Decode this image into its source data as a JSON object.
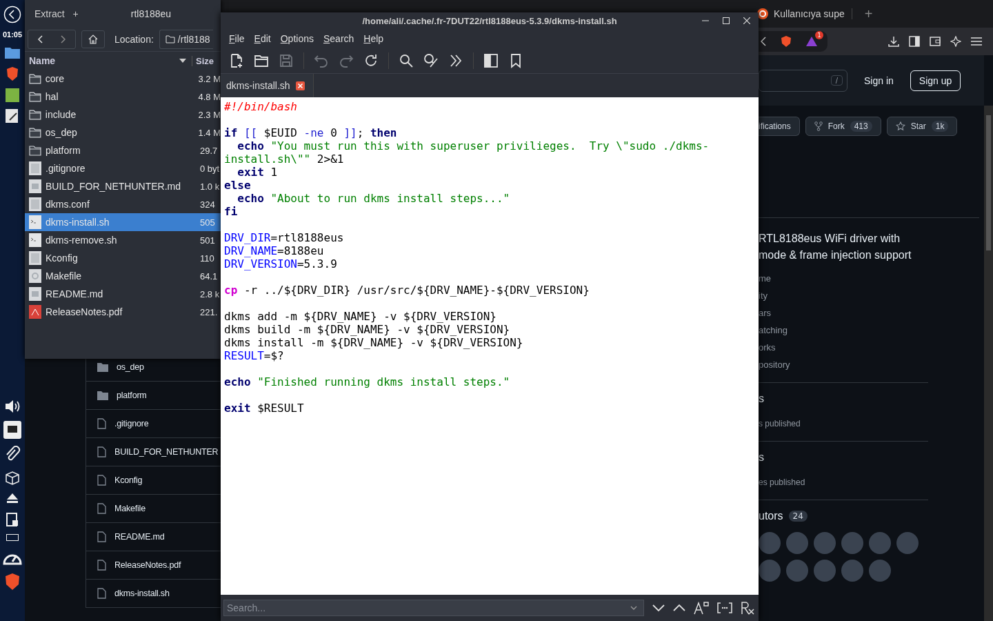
{
  "dock": {
    "time": "01:05"
  },
  "browser": {
    "tab_title": "Kullanıcıya supe",
    "new_tab": "+",
    "alert_count": "1",
    "header": {
      "search_key": "/",
      "sign_in": "Sign in",
      "sign_up": "Sign up"
    },
    "repo_actions": [
      {
        "label": "ifications"
      },
      {
        "label": "Fork",
        "count": "413"
      },
      {
        "label": "Star",
        "count": "1k"
      }
    ],
    "description": [
      "RTL8188eus WiFi driver with",
      "mode & frame injection support"
    ],
    "about_links": [
      "me",
      "ity",
      "ars",
      "atching",
      "orks",
      "pository"
    ],
    "sections": [
      {
        "heading": "s",
        "text": "s published"
      },
      {
        "heading": "s",
        "text": "es published"
      }
    ],
    "contributors": {
      "heading": "utors",
      "count": "24"
    },
    "files": [
      {
        "name": "os_dep",
        "kind": "folder"
      },
      {
        "name": "platform",
        "kind": "folder"
      },
      {
        "name": ".gitignore",
        "kind": "file"
      },
      {
        "name": "BUILD_FOR_NETHUNTER",
        "kind": "file"
      },
      {
        "name": "Kconfig",
        "kind": "file"
      },
      {
        "name": "Makefile",
        "kind": "file"
      },
      {
        "name": "README.md",
        "kind": "file"
      },
      {
        "name": "ReleaseNotes.pdf",
        "kind": "file"
      },
      {
        "name": "dkms-install.sh",
        "kind": "file"
      }
    ]
  },
  "archive": {
    "extract": "Extract",
    "add": "+",
    "tab_title": "rtl8188eu",
    "location_label": "Location:",
    "location": "/rtl8188",
    "columns": [
      "Name",
      "Size"
    ],
    "rows": [
      {
        "name": "core",
        "size": "3.2 M",
        "kind": "folder",
        "selected": false
      },
      {
        "name": "hal",
        "size": "4.8 M",
        "kind": "folder",
        "selected": false
      },
      {
        "name": "include",
        "size": "2.3 M",
        "kind": "folder",
        "selected": false
      },
      {
        "name": "os_dep",
        "size": "1.4 M",
        "kind": "folder",
        "selected": false
      },
      {
        "name": "platform",
        "size": "29.7",
        "kind": "folder",
        "selected": false
      },
      {
        "name": ".gitignore",
        "size": "0 byt",
        "kind": "text",
        "selected": false
      },
      {
        "name": "BUILD_FOR_NETHUNTER.md",
        "size": "1.0 k",
        "kind": "markdown",
        "selected": false
      },
      {
        "name": "dkms.conf",
        "size": "324",
        "kind": "text",
        "selected": false
      },
      {
        "name": "dkms-install.sh",
        "size": "505",
        "kind": "script",
        "selected": true
      },
      {
        "name": "dkms-remove.sh",
        "size": "501",
        "kind": "script",
        "selected": false
      },
      {
        "name": "Kconfig",
        "size": "110",
        "kind": "text",
        "selected": false
      },
      {
        "name": "Makefile",
        "size": "64.1",
        "kind": "settings",
        "selected": false
      },
      {
        "name": "README.md",
        "size": "2.8 k",
        "kind": "markdown",
        "selected": false
      },
      {
        "name": "ReleaseNotes.pdf",
        "size": "221.",
        "kind": "pdf",
        "selected": false
      }
    ]
  },
  "editor": {
    "title": "/home/ali/.cache/.fr-7DUT22/rtl8188eus-5.3.9/dkms-install.sh",
    "menu": [
      "File",
      "Edit",
      "Options",
      "Search",
      "Help"
    ],
    "toolbar_groups": [
      [
        {
          "kind": "new",
          "disabled": false
        },
        {
          "kind": "open",
          "disabled": false
        },
        {
          "kind": "save",
          "disabled": true
        }
      ],
      [
        {
          "kind": "undo",
          "disabled": true
        },
        {
          "kind": "redo",
          "disabled": true
        },
        {
          "kind": "reload",
          "disabled": false
        }
      ],
      [
        {
          "kind": "find",
          "disabled": false
        },
        {
          "kind": "replace",
          "disabled": false
        },
        {
          "kind": "goto",
          "disabled": false
        }
      ],
      [
        {
          "kind": "sidepanel",
          "disabled": false
        },
        {
          "kind": "bookmark",
          "disabled": false
        }
      ]
    ],
    "tab": "dkms-install.sh",
    "code_blocks": [
      [
        [
          {
            "t": "#!/bin/bash",
            "kind": "comment"
          }
        ]
      ],
      [
        [
          {
            "t": "if",
            "kind": "keyword"
          },
          {
            "t": " [[",
            "kind": "operator"
          },
          {
            "t": " $EUID",
            "kind": "plain"
          },
          {
            "t": " -ne",
            "kind": "operator"
          },
          {
            "t": " 0",
            "kind": "plain"
          },
          {
            "t": " ]]",
            "kind": "operator"
          },
          {
            "t": ";",
            "kind": "plain"
          },
          {
            "t": " then",
            "kind": "keyword"
          }
        ],
        [
          {
            "t": "  echo",
            "kind": "keyword"
          },
          {
            "t": " \"You must run this with superuser privilieges.  Try \\\"sudo ./dkms-",
            "kind": "string"
          }
        ],
        [
          {
            "t": "install.sh\\\"\"",
            "kind": "string"
          },
          {
            "t": " 2>&1",
            "kind": "plain"
          }
        ],
        [
          {
            "t": "  exit",
            "kind": "keyword"
          },
          {
            "t": " 1",
            "kind": "plain"
          }
        ],
        [
          {
            "t": "else",
            "kind": "keyword"
          }
        ],
        [
          {
            "t": "  echo",
            "kind": "keyword"
          },
          {
            "t": " \"About to run dkms install steps...\"",
            "kind": "string"
          }
        ],
        [
          {
            "t": "fi",
            "kind": "keyword"
          }
        ]
      ],
      [
        [
          {
            "t": "DRV_DIR",
            "kind": "variable"
          },
          {
            "t": "=rtl8188eus",
            "kind": "plain"
          }
        ],
        [
          {
            "t": "DRV_NAME",
            "kind": "variable"
          },
          {
            "t": "=8188eu",
            "kind": "plain"
          }
        ],
        [
          {
            "t": "DRV_VERSION",
            "kind": "variable"
          },
          {
            "t": "=5.3.9",
            "kind": "plain"
          }
        ]
      ],
      [
        [
          {
            "t": "cp",
            "kind": "command"
          },
          {
            "t": " -r ../${DRV_DIR} /usr/src/${DRV_NAME}-${DRV_VERSION}",
            "kind": "plain"
          }
        ]
      ],
      [
        [
          {
            "t": "dkms add -m ${DRV_NAME} -v ${DRV_VERSION}",
            "kind": "plain"
          }
        ],
        [
          {
            "t": "dkms build -m ${DRV_NAME} -v ${DRV_VERSION}",
            "kind": "plain"
          }
        ],
        [
          {
            "t": "dkms install -m ${DRV_NAME} -v ${DRV_VERSION}",
            "kind": "plain"
          }
        ],
        [
          {
            "t": "RESULT",
            "kind": "variable"
          },
          {
            "t": "=$?",
            "kind": "plain"
          }
        ]
      ],
      [
        [
          {
            "t": "echo",
            "kind": "keyword"
          },
          {
            "t": " \"Finished running dkms install steps.\"",
            "kind": "string"
          }
        ]
      ],
      [
        [
          {
            "t": "exit",
            "kind": "keyword"
          },
          {
            "t": " $RESULT",
            "kind": "plain"
          }
        ]
      ]
    ],
    "search_placeholder": "Search..."
  }
}
